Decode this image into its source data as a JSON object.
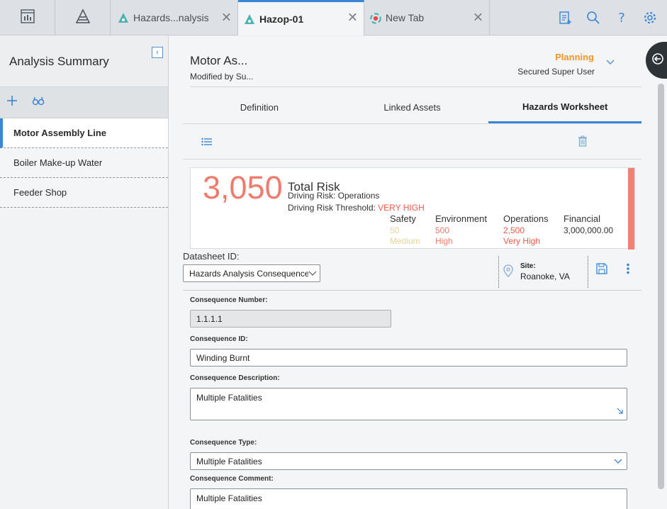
{
  "topbar": {
    "tabs": [
      {
        "label": "Hazards...nalysis"
      },
      {
        "label": "Hazop-01"
      },
      {
        "label": "New Tab"
      }
    ]
  },
  "sidebar": {
    "title": "Analysis Summary",
    "items": [
      {
        "label": "Motor Assembly Line"
      },
      {
        "label": "Boiler Make-up Water"
      },
      {
        "label": "Feeder Shop"
      }
    ]
  },
  "header": {
    "title": "Motor As...",
    "subtitle": "Modified by Su...",
    "state": "Planning",
    "user": "Secured Super User"
  },
  "tabs": [
    {
      "label": "Definition"
    },
    {
      "label": "Linked Assets"
    },
    {
      "label": "Hazards Worksheet"
    }
  ],
  "risk": {
    "total": "3,050",
    "label": "Total Risk",
    "driving": "Driving Risk: Operations",
    "threshold_label": "Driving Risk Threshold:",
    "threshold_value": "VERY HIGH",
    "categories": [
      {
        "name": "Safety",
        "value": "50",
        "level": "Medium",
        "color": "#e8d49a"
      },
      {
        "name": "Environment",
        "value": "500",
        "level": "High",
        "color": "#ef7b6c"
      },
      {
        "name": "Operations",
        "value": "2,500",
        "level": "Very High",
        "color": "#ef5a4a"
      },
      {
        "name": "Financial",
        "value": "3,000,000.00",
        "level": "",
        "color": "#333333"
      }
    ]
  },
  "datasheet": {
    "label": "Datasheet ID:",
    "value": "Hazards Analysis Consequence"
  },
  "site": {
    "label": "Site:",
    "value": "Roanoke, VA"
  },
  "fields": {
    "number_label": "Consequence Number:",
    "number_value": "1.1.1.1",
    "id_label": "Consequence ID:",
    "id_value": "Winding Burnt",
    "desc_label": "Consequence Description:",
    "desc_value": "Multiple Fatalities",
    "type_label": "Consequence Type:",
    "type_value": "Multiple Fatalities",
    "comment_label": "Consequence Comment:",
    "comment_value": "Multiple Fatalities"
  }
}
